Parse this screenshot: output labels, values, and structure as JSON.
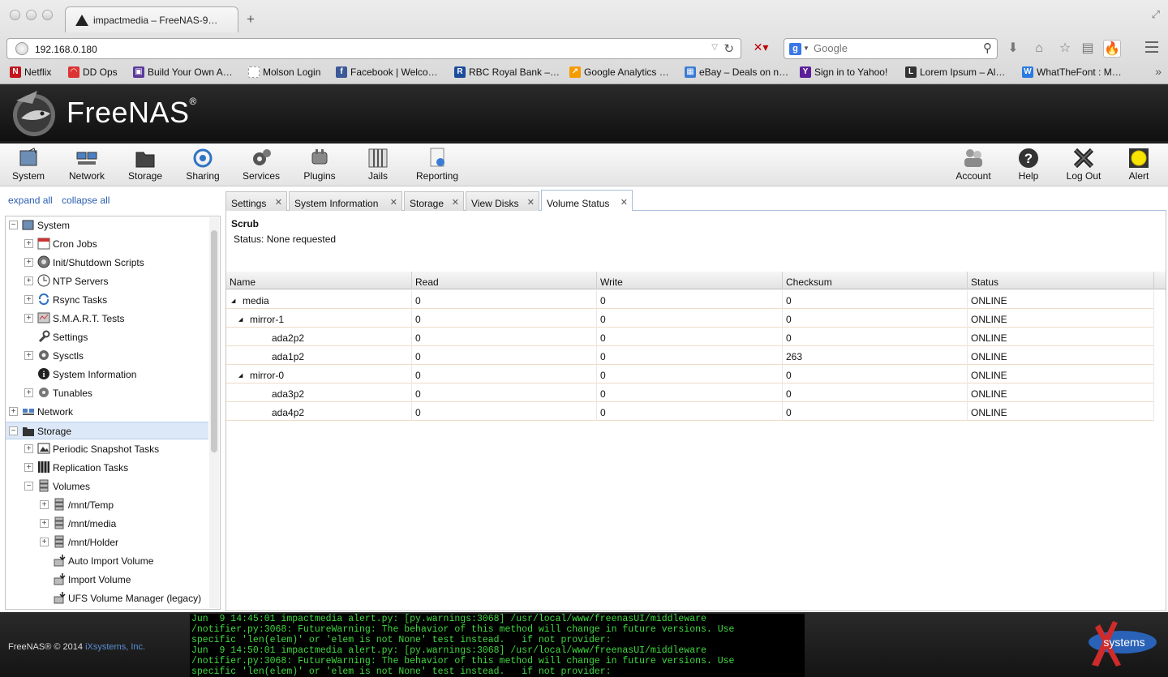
{
  "browser": {
    "tab_title": "impactmedia – FreeNAS-9…",
    "url": "192.168.0.180",
    "search_placeholder": "Google",
    "bookmarks": [
      {
        "label": "Netflix",
        "icon": "N",
        "color": "#c4151c"
      },
      {
        "label": "DD Ops",
        "icon": "◠",
        "color": "#d33"
      },
      {
        "label": "Build Your Own A…",
        "icon": "▣",
        "color": "#5b3a9b"
      },
      {
        "label": "Molson Login",
        "icon": "",
        "color": "#ffffff"
      },
      {
        "label": "Facebook | Welco…",
        "icon": "f",
        "color": "#3b5998"
      },
      {
        "label": "RBC Royal Bank –…",
        "icon": "R",
        "color": "#1b4b9b"
      },
      {
        "label": "Google Analytics …",
        "icon": "↗",
        "color": "#f59b00"
      },
      {
        "label": "eBay – Deals on n…",
        "icon": "▦",
        "color": "#3b7bd4"
      },
      {
        "label": "Sign in to Yahoo!",
        "icon": "Y",
        "color": "#5b1e9b"
      },
      {
        "label": "Lorem Ipsum – Al…",
        "icon": "L",
        "color": "#333333"
      },
      {
        "label": "WhatTheFont : M…",
        "icon": "W",
        "color": "#2a7ae2"
      }
    ]
  },
  "app": {
    "brand": "FreeNAS",
    "brand_mark": "®"
  },
  "topnav": {
    "left": [
      {
        "label": "System",
        "icon": "system-icon"
      },
      {
        "label": "Network",
        "icon": "network-icon"
      },
      {
        "label": "Storage",
        "icon": "storage-icon"
      },
      {
        "label": "Sharing",
        "icon": "sharing-icon"
      },
      {
        "label": "Services",
        "icon": "services-icon"
      },
      {
        "label": "Plugins",
        "icon": "plugins-icon"
      },
      {
        "label": "Jails",
        "icon": "jails-icon"
      },
      {
        "label": "Reporting",
        "icon": "reporting-icon"
      }
    ],
    "right": [
      {
        "label": "Account",
        "icon": "account-icon"
      },
      {
        "label": "Help",
        "icon": "help-icon"
      },
      {
        "label": "Log Out",
        "icon": "logout-icon"
      },
      {
        "label": "Alert",
        "icon": "alert-icon"
      }
    ]
  },
  "tree": {
    "expand_all": "expand all",
    "collapse_all": "collapse all",
    "nodes": [
      {
        "label": "System",
        "level": 0,
        "expander": "−",
        "icon": "system-icon"
      },
      {
        "label": "Cron Jobs",
        "level": 1,
        "expander": "+",
        "icon": "calendar-icon"
      },
      {
        "label": "Init/Shutdown Scripts",
        "level": 1,
        "expander": "+",
        "icon": "power-icon"
      },
      {
        "label": "NTP Servers",
        "level": 1,
        "expander": "+",
        "icon": "clock-icon"
      },
      {
        "label": "Rsync Tasks",
        "level": 1,
        "expander": "+",
        "icon": "sync-icon"
      },
      {
        "label": "S.M.A.R.T. Tests",
        "level": 1,
        "expander": "+",
        "icon": "smart-icon"
      },
      {
        "label": "Settings",
        "level": 1,
        "expander": "",
        "icon": "wrench-icon"
      },
      {
        "label": "Sysctls",
        "level": 1,
        "expander": "+",
        "icon": "gears-icon"
      },
      {
        "label": "System Information",
        "level": 1,
        "expander": "",
        "icon": "info-icon"
      },
      {
        "label": "Tunables",
        "level": 1,
        "expander": "+",
        "icon": "tunables-icon"
      },
      {
        "label": "Network",
        "level": 0,
        "expander": "+",
        "icon": "network-icon"
      },
      {
        "label": "Storage",
        "level": 0,
        "expander": "−",
        "icon": "storage-icon",
        "selected": true
      },
      {
        "label": "Periodic Snapshot Tasks",
        "level": 1,
        "expander": "+",
        "icon": "snapshot-icon"
      },
      {
        "label": "Replication Tasks",
        "level": 1,
        "expander": "+",
        "icon": "replication-icon"
      },
      {
        "label": "Volumes",
        "level": 1,
        "expander": "−",
        "icon": "volume-icon"
      },
      {
        "label": "/mnt/Temp",
        "level": 2,
        "expander": "+",
        "icon": "volume-icon"
      },
      {
        "label": "/mnt/media",
        "level": 2,
        "expander": "+",
        "icon": "volume-icon"
      },
      {
        "label": "/mnt/Holder",
        "level": 2,
        "expander": "+",
        "icon": "volume-icon"
      },
      {
        "label": "Auto Import Volume",
        "level": 2,
        "expander": "",
        "icon": "import-icon"
      },
      {
        "label": "Import Volume",
        "level": 2,
        "expander": "",
        "icon": "import-icon"
      },
      {
        "label": "UFS Volume Manager (legacy)",
        "level": 2,
        "expander": "",
        "icon": "import-icon"
      }
    ]
  },
  "tabs": [
    {
      "label": "Settings",
      "active": false
    },
    {
      "label": "System Information",
      "active": false
    },
    {
      "label": "Storage",
      "active": false
    },
    {
      "label": "View Disks",
      "active": false
    },
    {
      "label": "Volume Status",
      "active": true
    }
  ],
  "scrub": {
    "title": "Scrub",
    "status": "Status: None requested"
  },
  "grid": {
    "columns": [
      "Name",
      "Read",
      "Write",
      "Checksum",
      "Status"
    ],
    "rows": [
      {
        "name": "media",
        "level": 0,
        "arrow": "◢",
        "read": "0",
        "write": "0",
        "checksum": "0",
        "status": "ONLINE"
      },
      {
        "name": "mirror-1",
        "level": 1,
        "arrow": "◢",
        "read": "0",
        "write": "0",
        "checksum": "0",
        "status": "ONLINE"
      },
      {
        "name": "ada2p2",
        "level": 2,
        "arrow": "",
        "read": "0",
        "write": "0",
        "checksum": "0",
        "status": "ONLINE"
      },
      {
        "name": "ada1p2",
        "level": 2,
        "arrow": "",
        "read": "0",
        "write": "0",
        "checksum": "263",
        "status": "ONLINE"
      },
      {
        "name": "mirror-0",
        "level": 1,
        "arrow": "◢",
        "read": "0",
        "write": "0",
        "checksum": "0",
        "status": "ONLINE"
      },
      {
        "name": "ada3p2",
        "level": 2,
        "arrow": "",
        "read": "0",
        "write": "0",
        "checksum": "0",
        "status": "ONLINE"
      },
      {
        "name": "ada4p2",
        "level": 2,
        "arrow": "",
        "read": "0",
        "write": "0",
        "checksum": "0",
        "status": "ONLINE"
      }
    ]
  },
  "footer": {
    "copyright": "FreeNAS® © 2014 ",
    "company": "iXsystems, Inc.",
    "ix_logo_text": "systems",
    "console_lines": [
      "Jun  9 14:45:01 impactmedia alert.py: [py.warnings:3068] /usr/local/www/freenasUI/middleware",
      "/notifier.py:3068: FutureWarning: The behavior of this method will change in future versions. Use",
      "specific 'len(elem)' or 'elem is not None' test instead.   if not provider:",
      "Jun  9 14:50:01 impactmedia alert.py: [py.warnings:3068] /usr/local/www/freenasUI/middleware",
      "/notifier.py:3068: FutureWarning: The behavior of this method will change in future versions. Use",
      "specific 'len(elem)' or 'elem is not None' test instead.   if not provider:"
    ]
  }
}
